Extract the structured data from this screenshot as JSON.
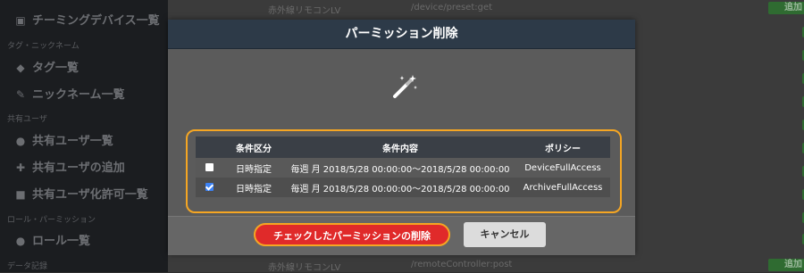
{
  "sidebar": {
    "items": [
      {
        "label": "チーミングデバイス一覧",
        "icon": "camera-icon"
      },
      {
        "label": "タグ一覧",
        "icon": "tags-icon"
      },
      {
        "label": "ニックネーム一覧",
        "icon": "pencil-icon"
      },
      {
        "label": "共有ユーザ一覧",
        "icon": "user-icon"
      },
      {
        "label": "共有ユーザの追加",
        "icon": "user-plus-icon"
      },
      {
        "label": "共有ユーザ化許可一覧",
        "icon": "lock-icon"
      },
      {
        "label": "ロール一覧",
        "icon": "users-icon"
      }
    ],
    "sections": [
      "タグ・ニックネーム",
      "共有ユーザ",
      "ロール・パーミッション",
      "データ記録"
    ]
  },
  "background": {
    "top_row": {
      "name": "赤外線リモコンLV",
      "path": "/device/preset:get",
      "button": "追加"
    },
    "bottom_row": {
      "name": "赤外線リモコンLV",
      "path": "/remoteController:post",
      "button": "追加"
    }
  },
  "modal": {
    "title": "パーミッション削除",
    "icon": "magic-wand-icon",
    "table": {
      "headers": [
        "",
        "条件区分",
        "条件内容",
        "ポリシー"
      ],
      "rows": [
        {
          "checked": false,
          "type": "日時指定",
          "condition": "毎週 月 2018/5/28 00:00:00〜2018/5/28 00:00:00",
          "policy": "DeviceFullAccess"
        },
        {
          "checked": true,
          "type": "日時指定",
          "condition": "毎週 月 2018/5/28 00:00:00〜2018/5/28 00:00:00",
          "policy": "ArchiveFullAccess"
        }
      ]
    },
    "delete_button": "チェックしたパーミッションの削除",
    "cancel_button": "キャンセル"
  },
  "colors": {
    "header_bg": "#2d3a48",
    "highlight": "#f5a623",
    "danger": "#e02a2a",
    "add_button": "#2f6b31"
  }
}
